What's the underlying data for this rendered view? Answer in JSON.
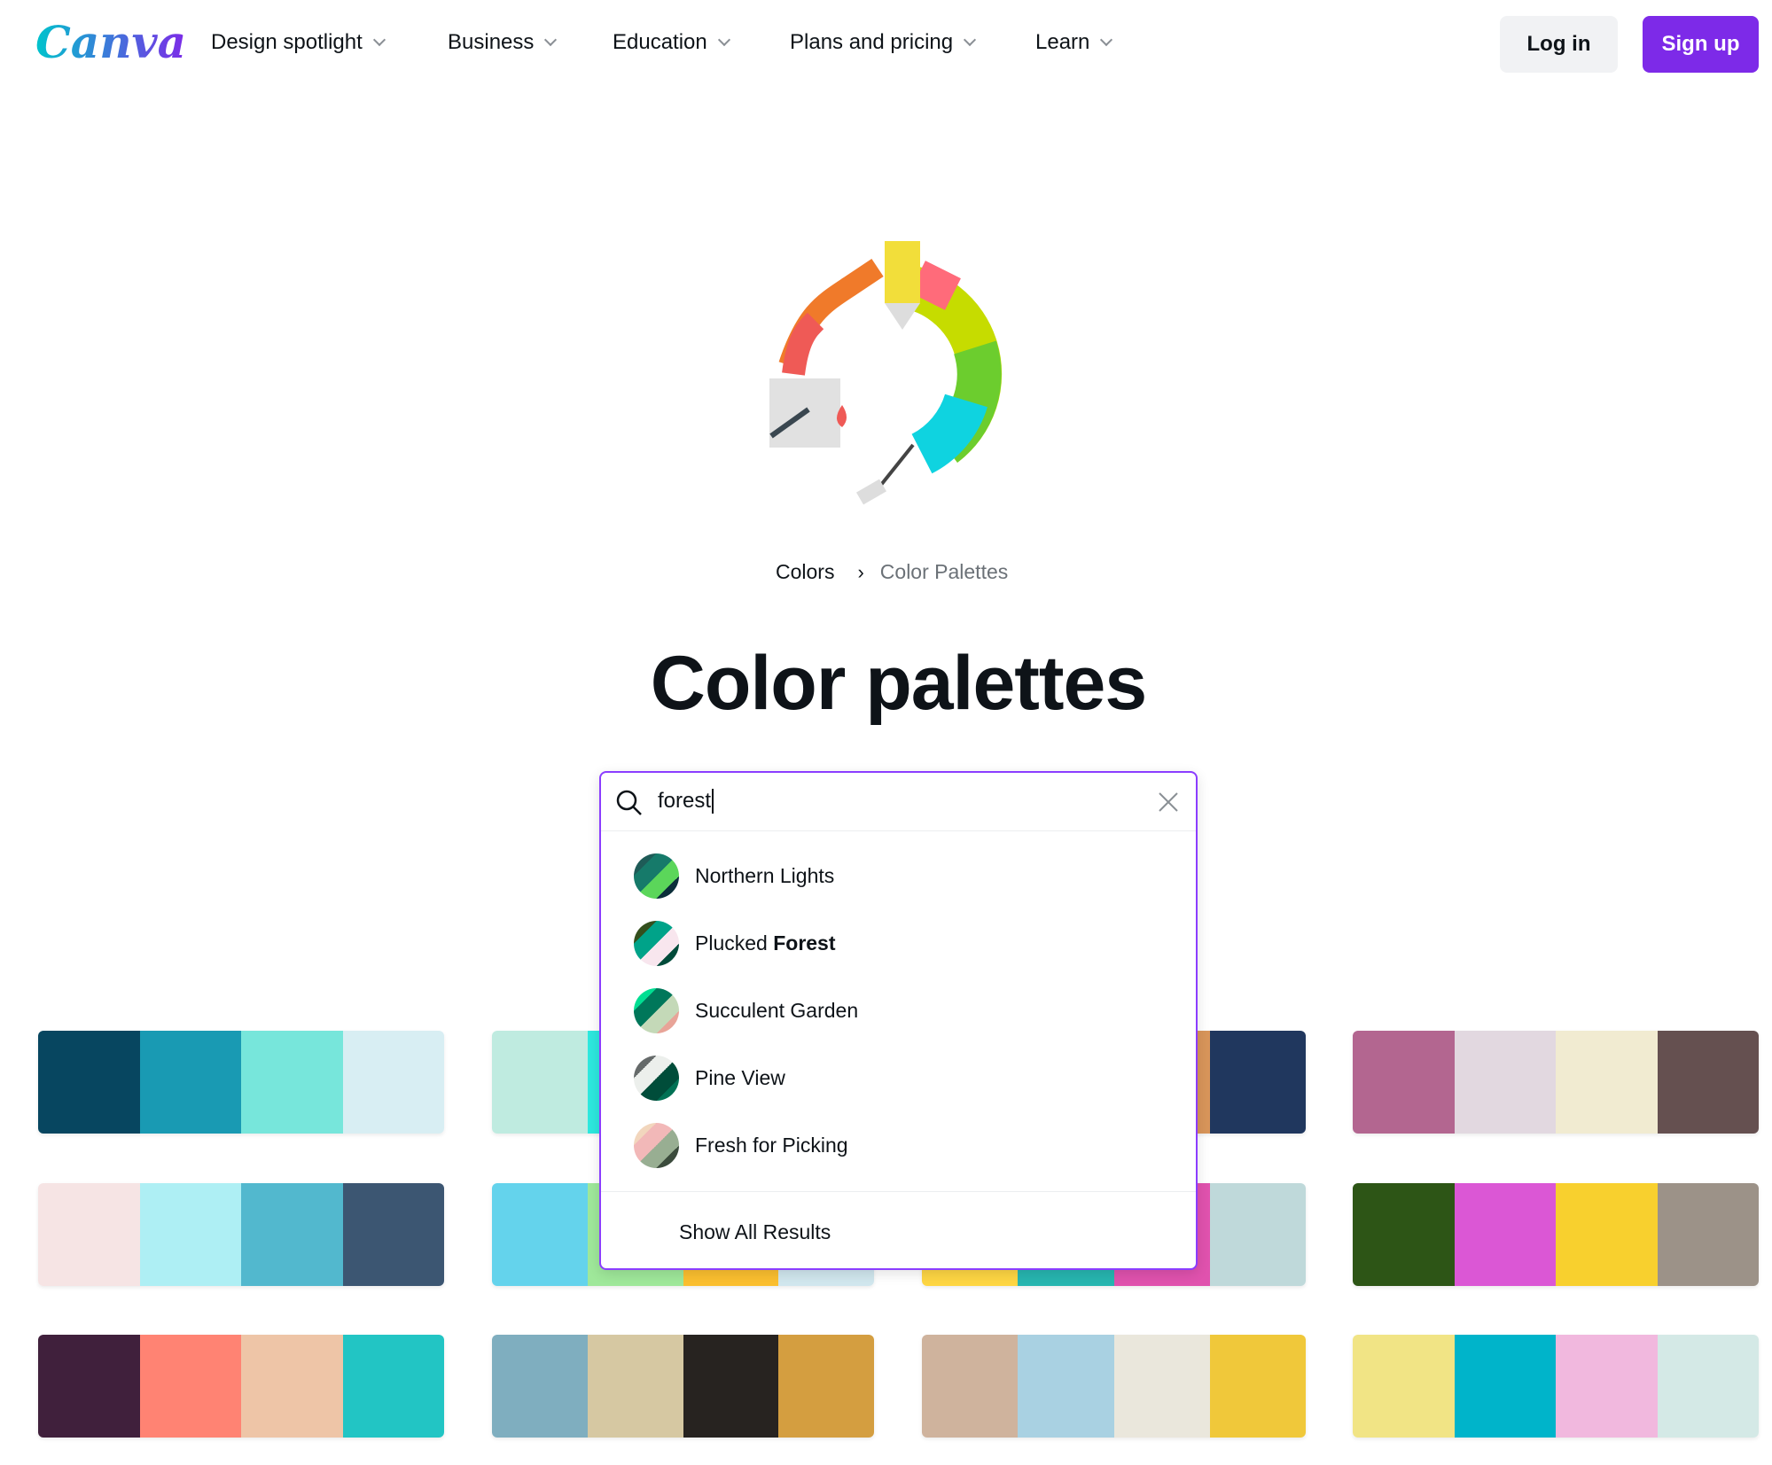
{
  "header": {
    "logo": "Canva",
    "nav": [
      "Design spotlight",
      "Business",
      "Education",
      "Plans and pricing",
      "Learn"
    ],
    "login": "Log in",
    "signup": "Sign up"
  },
  "breadcrumb": {
    "parent": "Colors",
    "current": "Color Palettes"
  },
  "page_title": "Color palettes",
  "search": {
    "value": "forest",
    "suggestions": [
      {
        "pre": "Northern Lights",
        "bold": "",
        "colors": [
          "#1E5B57",
          "#167A6A",
          "#5BD65A",
          "#0B2E3A"
        ]
      },
      {
        "pre": "Plucked ",
        "bold": "Forest",
        "colors": [
          "#344F1D",
          "#00A389",
          "#F8E6EE",
          "#004B3A"
        ]
      },
      {
        "pre": "Succulent Garden",
        "bold": "",
        "colors": [
          "#00DE92",
          "#00775A",
          "#C4D9B8",
          "#E8A498"
        ]
      },
      {
        "pre": "Pine View",
        "bold": "",
        "colors": [
          "#656A6A",
          "#ECEFEC",
          "#004D3A",
          "#007154"
        ]
      },
      {
        "pre": "Fresh for Picking",
        "bold": "",
        "colors": [
          "#F2D6BD",
          "#F2B8B8",
          "#98AE92",
          "#3B4B3C"
        ]
      }
    ],
    "show_all": "Show All Results"
  },
  "accent": "#7D2AE8",
  "palettes": [
    [
      [
        "#074660",
        "#199AB3",
        "#77E6DB",
        "#D8EEF3"
      ],
      [
        "#BFEBE0",
        "#2DE8DE",
        "#2DE8DE",
        "#2DE8DE"
      ],
      [
        "#D8955A",
        "#D8955A",
        "#D8955A",
        "#20375E"
      ],
      [
        "#B36690",
        "#E2D8E0",
        "#F1EBD1",
        "#655050"
      ]
    ],
    [
      [
        "#F6E4E4",
        "#AEEFF4",
        "#52B8CE",
        "#3C5672"
      ],
      [
        "#64D3EC",
        "#9FE89A",
        "#FBBF2F",
        "#D1E7EE"
      ],
      [
        "#FED643",
        "#27B6B0",
        "#E052AE",
        "#BFD9DA"
      ],
      [
        "#2D5516",
        "#DB57D5",
        "#F8D02E",
        "#9C9288"
      ]
    ],
    [
      [
        "#40203C",
        "#FF8373",
        "#EEC5A7",
        "#22C5C4"
      ],
      [
        "#7FAEBF",
        "#D6C8A2",
        "#272320",
        "#D49E40"
      ],
      [
        "#CFB39D",
        "#A9D1E2",
        "#EAE7DC",
        "#F0C83A"
      ],
      [
        "#F1E485",
        "#00B4CA",
        "#F1B8DE",
        "#D4E9E6"
      ]
    ]
  ]
}
